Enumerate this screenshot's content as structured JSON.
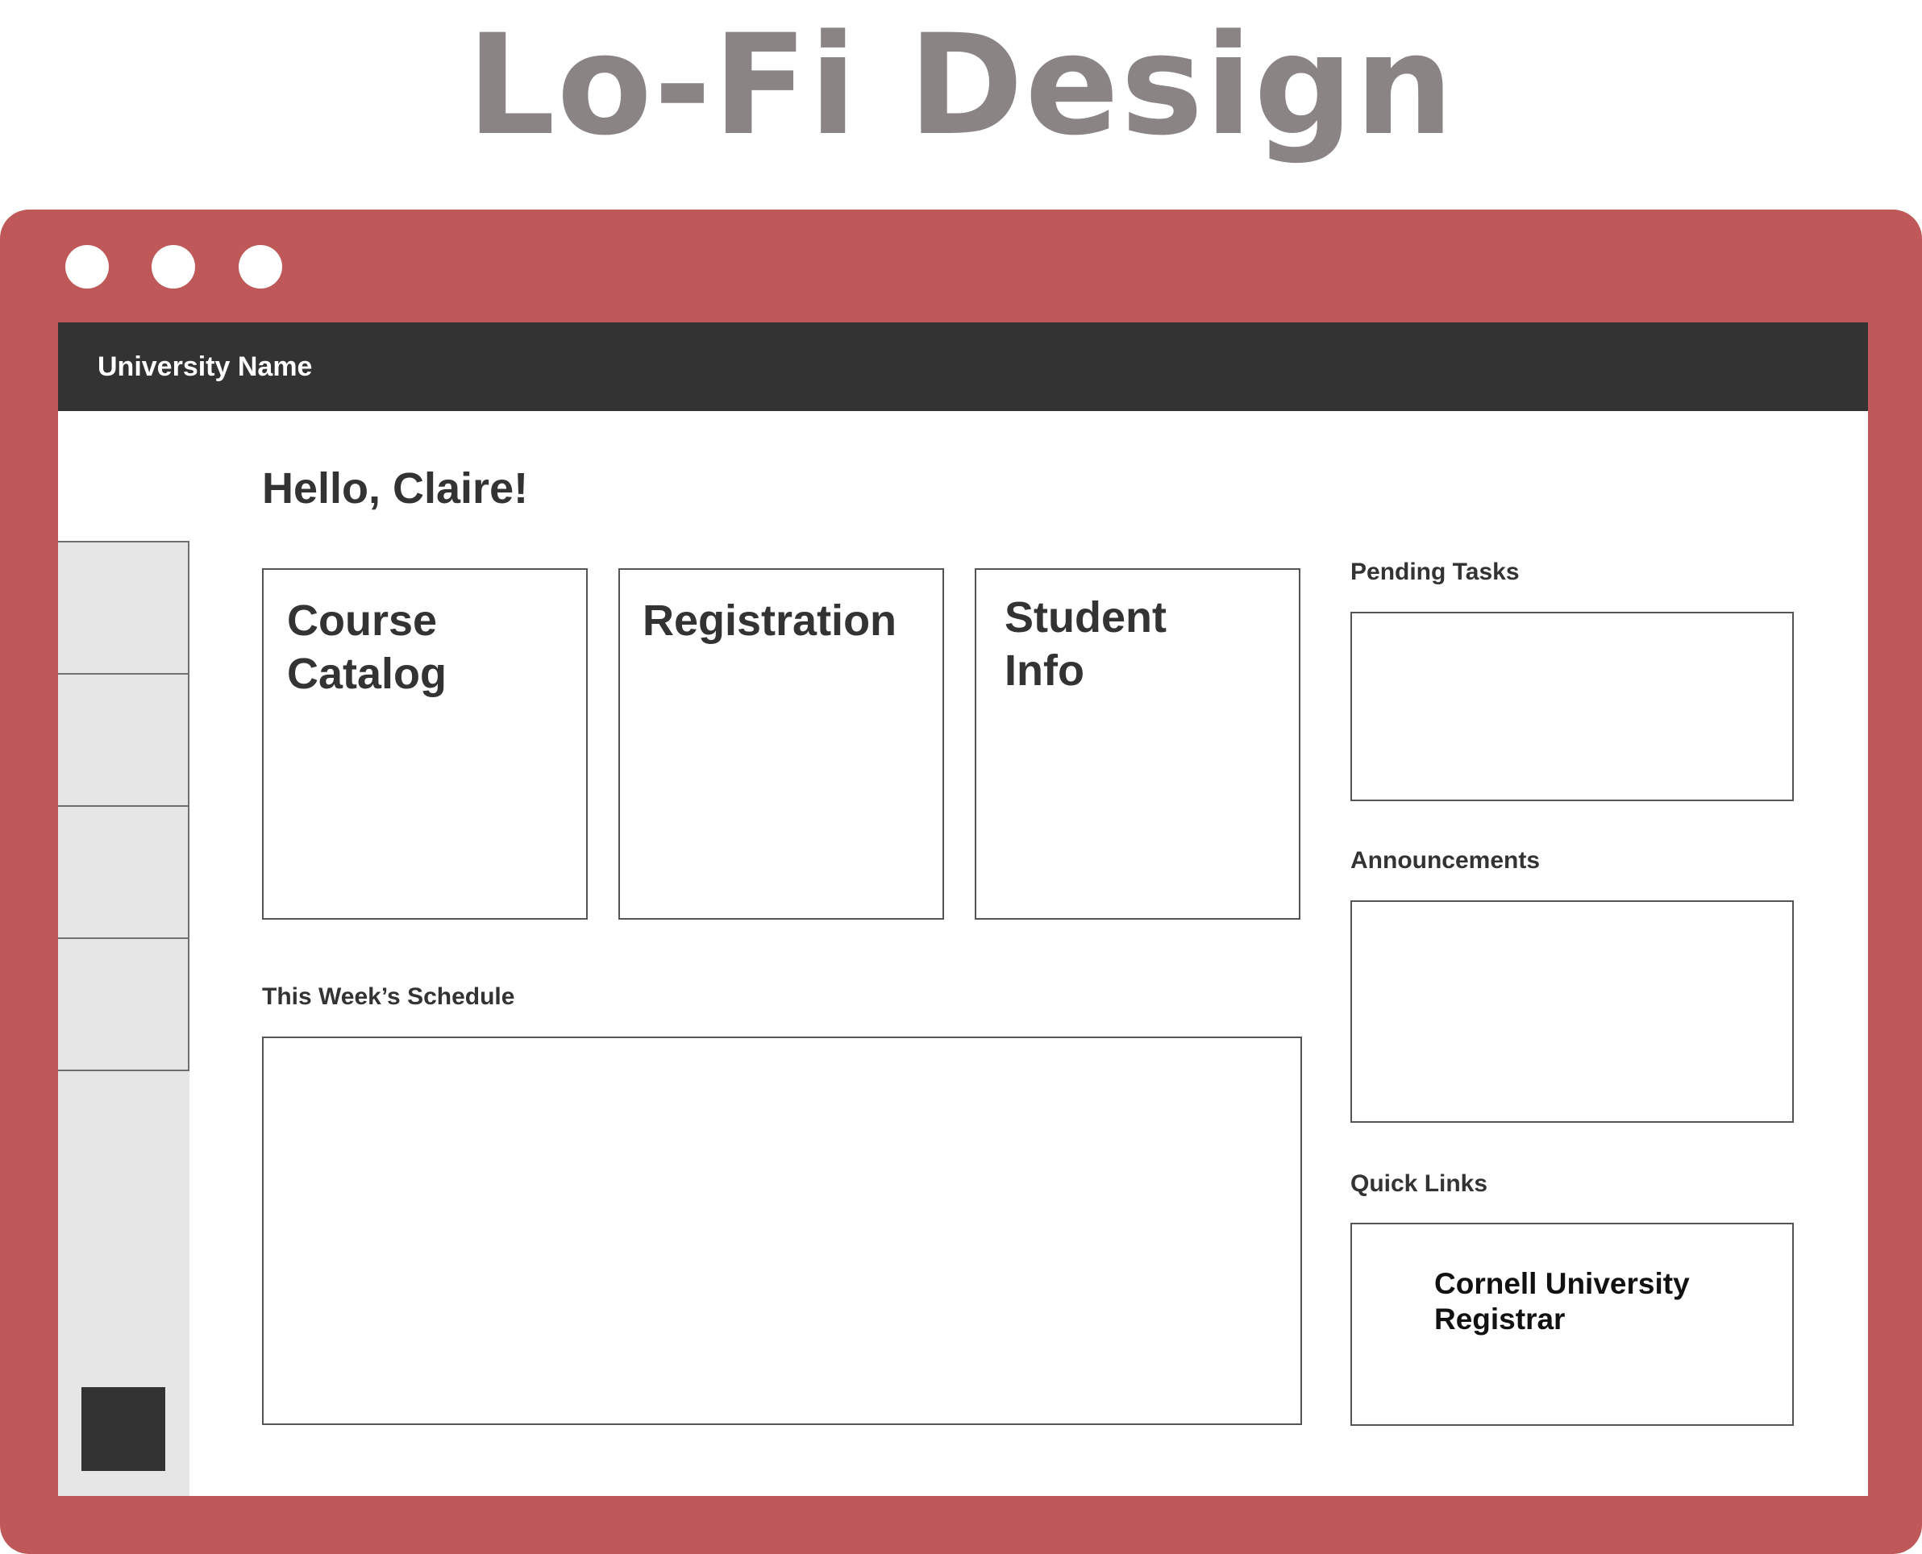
{
  "page_title": "Lo-Fi Design",
  "app": {
    "brand": "University Name",
    "greeting": "Hello, Claire!",
    "cards": [
      {
        "label": "Course\nCatalog"
      },
      {
        "label": "Registration"
      },
      {
        "label": "Student\nInfo"
      }
    ],
    "sections": {
      "schedule": "This Week’s Schedule",
      "pending": "Pending Tasks",
      "announcements": "Announcements",
      "quick_links": "Quick Links"
    },
    "quick_links": [
      {
        "label": "Cornell University Registrar"
      }
    ]
  },
  "colors": {
    "frame": "#bf5959",
    "topbar": "#333333",
    "sidebar": "#e6e6e6",
    "title": "#8b8484"
  }
}
